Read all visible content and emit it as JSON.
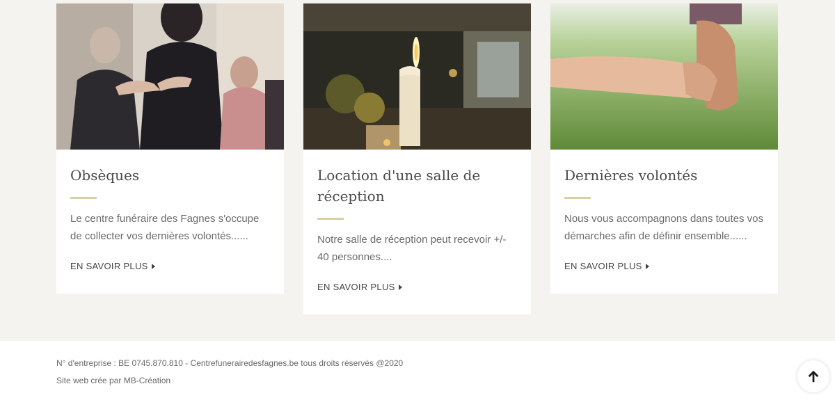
{
  "cards": [
    {
      "title": "Obsèques",
      "text": "Le centre funéraire des Fagnes s'occupe de collecter vos dernières volontés......",
      "link": "EN SAVOIR PLUS",
      "image": "people-praying-at-funeral"
    },
    {
      "title": "Location d'une salle de réception",
      "text": "Notre salle de réception peut recevoir +/- 40 personnes....",
      "link": "EN SAVOIR PLUS",
      "image": "lit-candle"
    },
    {
      "title": "Dernières volontés",
      "text": "Nous vous accompagnons dans toutes vos démarches afin de définir ensemble......",
      "link": "EN SAVOIR PLUS",
      "image": "hands-holding-on-grass"
    }
  ],
  "footer": {
    "line1": "N° d'entreprise : BE 0745.870.810 - Centrefunerairedesfagnes.be tous droits réservés @2020",
    "line2": "Site web crée par MB-Création"
  },
  "scroll_top_icon": "arrow-up-icon",
  "colors": {
    "page_bg": "#f5f3f0",
    "accent_rule": "#d8cfa6"
  }
}
